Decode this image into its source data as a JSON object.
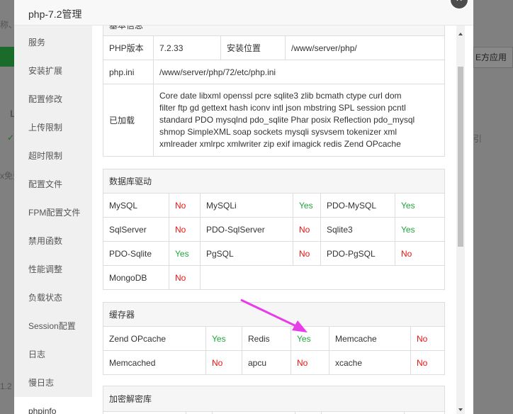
{
  "background": {
    "fragments": [
      "称、字",
      "L",
      "✓",
      "x免费",
      "引",
      "E方应用",
      "1.2"
    ]
  },
  "dialog": {
    "title": "php-7.2管理",
    "close_glyph": "×"
  },
  "sidebar": {
    "items": [
      "服务",
      "安装扩展",
      "配置修改",
      "上传限制",
      "超时限制",
      "配置文件",
      "FPM配置文件",
      "禁用函数",
      "性能调整",
      "负载状态",
      "Session配置",
      "日志",
      "慢日志",
      "phpinfo"
    ]
  },
  "basic_info": {
    "header": "基本信息",
    "version_label": "PHP版本",
    "version": "7.2.33",
    "install_label": "安装位置",
    "install_path": "/www/server/php/",
    "ini_label": "php.ini",
    "ini_path": "/www/server/php/72/etc/php.ini",
    "loaded_label": "已加载",
    "loaded_lines": [
      "Core date libxml openssl pcre sqlite3 zlib bcmath ctype curl dom",
      "filter ftp gd gettext hash iconv intl json mbstring SPL session pcntl",
      "standard PDO mysqlnd pdo_sqlite Phar posix Reflection pdo_mysql",
      "shmop SimpleXML soap sockets mysqli sysvsem tokenizer xml",
      "xmlreader xmlrpc xmlwriter zip exif imagick redis Zend OPcache"
    ]
  },
  "db_drivers": {
    "header": "数据库驱动",
    "rows": [
      [
        {
          "name": "MySQL",
          "status": "No"
        },
        {
          "name": "MySQLi",
          "status": "Yes"
        },
        {
          "name": "PDO-MySQL",
          "status": "Yes"
        }
      ],
      [
        {
          "name": "SqlServer",
          "status": "No"
        },
        {
          "name": "PDO-SqlServer",
          "status": "No"
        },
        {
          "name": "Sqlite3",
          "status": "Yes"
        }
      ],
      [
        {
          "name": "PDO-Sqlite",
          "status": "Yes"
        },
        {
          "name": "PgSQL",
          "status": "No"
        },
        {
          "name": "PDO-PgSQL",
          "status": "No"
        }
      ],
      [
        {
          "name": "MongoDB",
          "status": "No"
        }
      ]
    ]
  },
  "cache": {
    "header": "缓存器",
    "rows": [
      [
        {
          "name": "Zend OPcache",
          "status": "Yes"
        },
        {
          "name": "Redis",
          "status": "Yes"
        },
        {
          "name": "Memcache",
          "status": "No"
        }
      ],
      [
        {
          "name": "Memcached",
          "status": "No"
        },
        {
          "name": "apcu",
          "status": "No"
        },
        {
          "name": "xcache",
          "status": "No"
        }
      ]
    ]
  },
  "crypto": {
    "header": "加密解密库"
  },
  "colors": {
    "yes": "#20a53a",
    "no": "#ee1111",
    "annotation_arrow": "#e83ce8"
  }
}
